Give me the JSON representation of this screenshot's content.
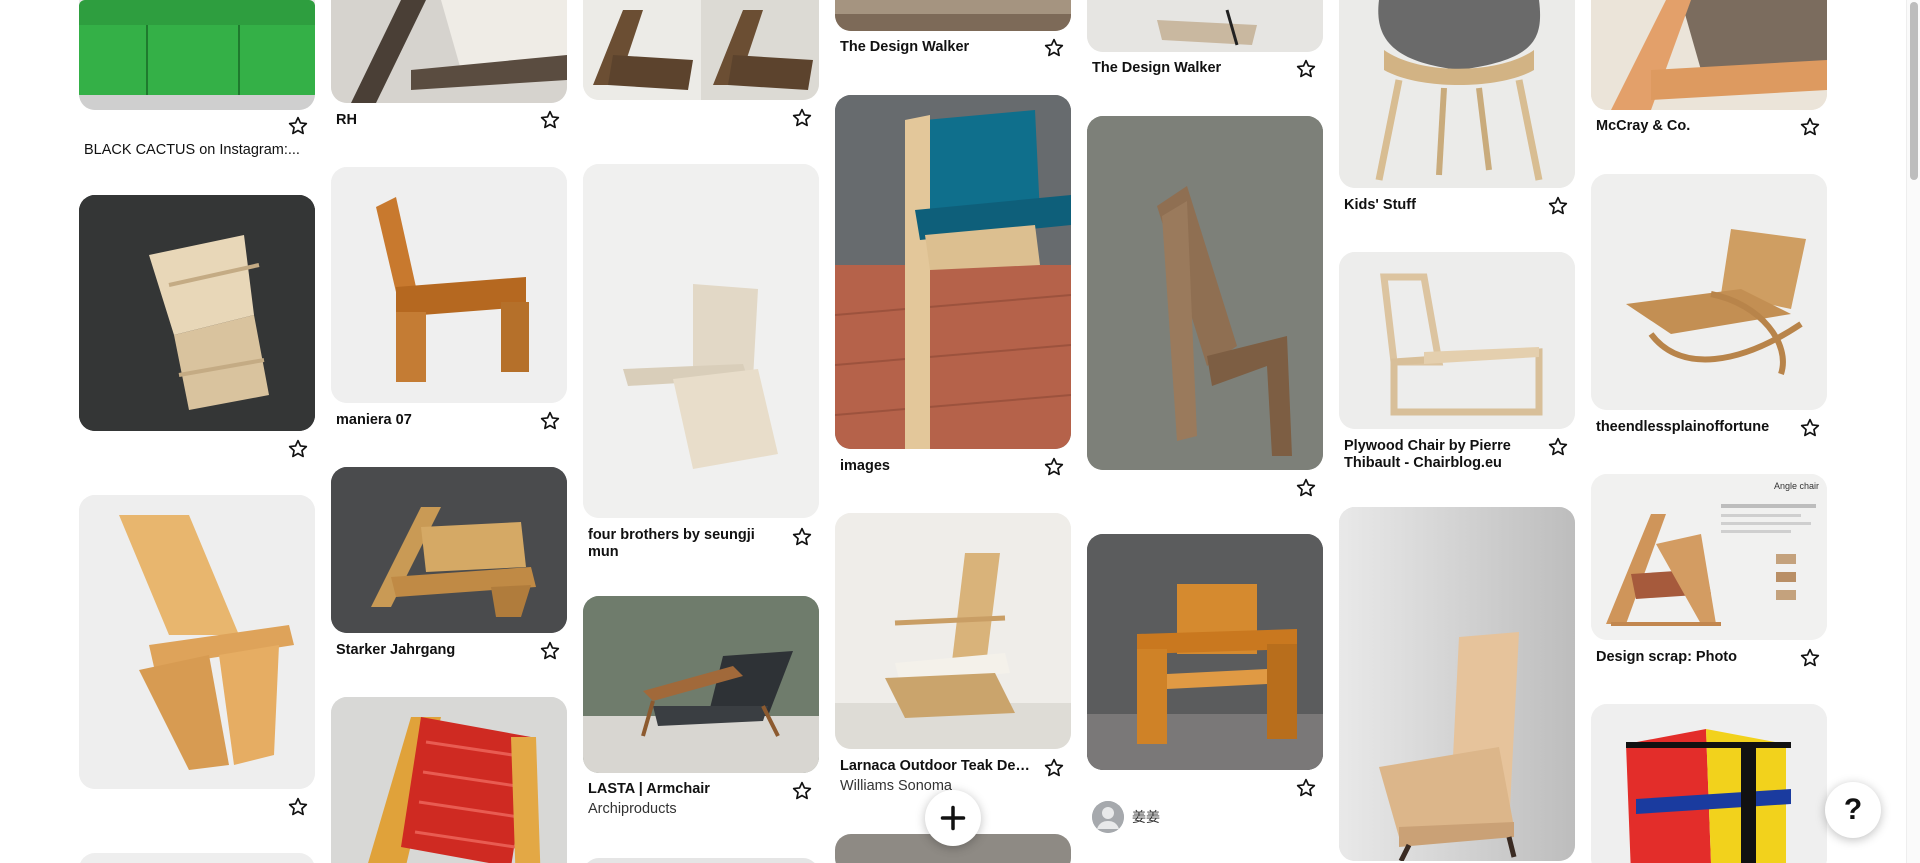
{
  "pins": {
    "p1": {
      "title": "BLACK CACTUS on Instagram:..."
    },
    "p4": {
      "title": "RH"
    },
    "p5": {
      "title": "maniera 07"
    },
    "p6": {
      "title": "Starker Jahrgang"
    },
    "p9": {
      "title": "four brothers by seungji mun"
    },
    "p10": {
      "title": "LASTA | Armchair",
      "subtitle": "Archiproducts"
    },
    "p12": {
      "title": "The Design Walker"
    },
    "p13": {
      "title": "images"
    },
    "p14": {
      "title": "Larnaca Outdoor Teak Dec...",
      "subtitle": "Williams Sonoma"
    },
    "p16": {
      "title": "The Design Walker"
    },
    "p18": {
      "owner": "姜姜"
    },
    "p19": {
      "title": "Kids' Stuff"
    },
    "p20": {
      "title": "Plywood Chair by Pierre Thibault - Chairblog.eu"
    },
    "p22": {
      "title": "McCray & Co."
    },
    "p23": {
      "title": "theendlessplainoffortune"
    },
    "p24": {
      "title": "Design scrap: Photo",
      "image_text": "Angle chair"
    }
  },
  "icons": {
    "star": "star-outline-icon",
    "add": "plus-icon",
    "help": "question-mark-icon",
    "avatar": "user-avatar-icon"
  },
  "help_label": "?",
  "colors": {
    "background": "#ffffff",
    "text": "#111111"
  }
}
